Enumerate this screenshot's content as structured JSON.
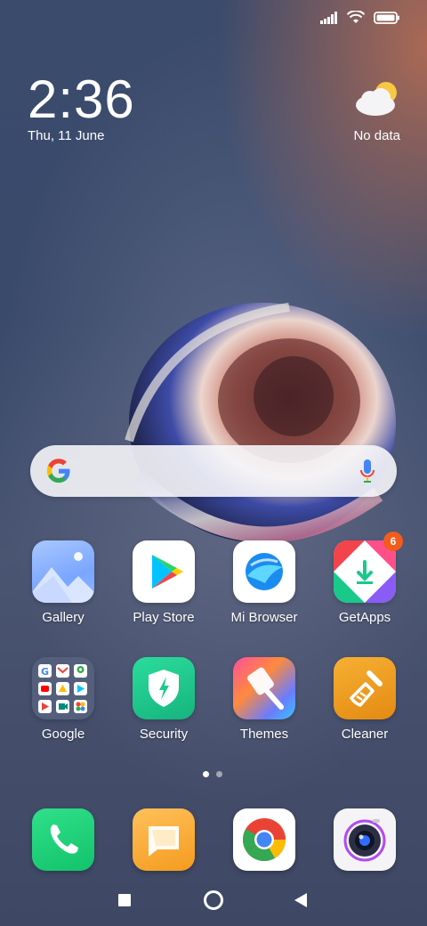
{
  "status_bar": {
    "icons": [
      "signal-icon",
      "wifi-icon",
      "battery-icon"
    ]
  },
  "lockscreen_widget": {
    "time": "2:36",
    "date": "Thu, 11 June",
    "weather_icon": "partly-cloudy-icon",
    "weather_text": "No data"
  },
  "search": {
    "logo": "google-g-icon",
    "mic": "mic-icon"
  },
  "apps_row1": [
    {
      "label": "Gallery",
      "icon": "gallery-icon"
    },
    {
      "label": "Play Store",
      "icon": "play-store-icon"
    },
    {
      "label": "Mi Browser",
      "icon": "mi-browser-icon"
    },
    {
      "label": "GetApps",
      "icon": "getapps-icon",
      "badge": "6"
    }
  ],
  "apps_row2": [
    {
      "label": "Google",
      "icon": "google-folder-icon"
    },
    {
      "label": "Security",
      "icon": "security-icon"
    },
    {
      "label": "Themes",
      "icon": "themes-icon"
    },
    {
      "label": "Cleaner",
      "icon": "cleaner-icon"
    }
  ],
  "page_indicator": {
    "pages": 2,
    "current": 1
  },
  "dock": [
    "phone-icon",
    "messages-icon",
    "chrome-icon",
    "camera-icon"
  ],
  "nav_bar": [
    "recents-button",
    "home-button",
    "back-button"
  ],
  "colors": {
    "badge": "#f35b1d",
    "phone": "#1fd37a",
    "security": "#1ec98e",
    "cleaner": "#f0a019"
  }
}
